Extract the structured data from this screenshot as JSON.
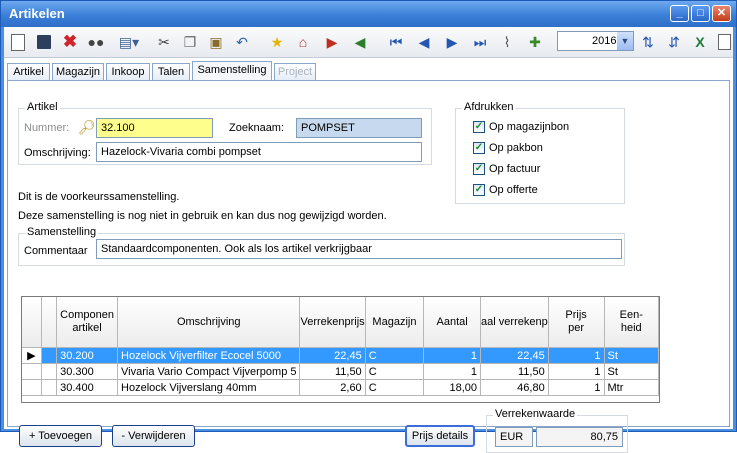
{
  "window": {
    "title": "Artikelen"
  },
  "toolbar": {
    "icons": [
      "new-icon",
      "save-icon",
      "delete-icon",
      "binoculars-icon",
      "print-icon",
      "cut-icon",
      "copy-icon",
      "paste-icon",
      "undo-icon",
      "star-icon",
      "house-icon",
      "export-icon",
      "import-icon",
      "first-icon",
      "prev-icon",
      "next-icon",
      "last-icon",
      "attach-icon",
      "add-icon",
      "sort-asc-icon",
      "sort-desc-icon",
      "excel-icon",
      "page-icon"
    ],
    "year": "2016"
  },
  "tabs": [
    {
      "label": "Artikel",
      "state": "normal"
    },
    {
      "label": "Magazijn",
      "state": "normal"
    },
    {
      "label": "Inkoop",
      "state": "normal"
    },
    {
      "label": "Talen",
      "state": "normal"
    },
    {
      "label": "Samenstelling",
      "state": "active"
    },
    {
      "label": "Project",
      "state": "disabled"
    }
  ],
  "artikel": {
    "legend": "Artikel",
    "nummer_label": "Nummer:",
    "nummer_value": "32.100",
    "zoeknaam_label": "Zoeknaam:",
    "zoeknaam_value": "POMPSET",
    "omschrijving_label": "Omschrijving:",
    "omschrijving_value": "Hazelock-Vivaria combi pompset"
  },
  "afdrukken": {
    "legend": "Afdrukken",
    "options": [
      {
        "label": "Op magazijnbon",
        "checked": true
      },
      {
        "label": "Op pakbon",
        "checked": true
      },
      {
        "label": "Op factuur",
        "checked": true
      },
      {
        "label": "Op offerte",
        "checked": true
      }
    ]
  },
  "messages": {
    "line1": "Dit is de voorkeurssamenstelling.",
    "line2": "Deze samenstelling is nog niet in gebruik en kan dus nog gewijzigd worden."
  },
  "samenstelling": {
    "legend": "Samenstelling",
    "commentaar_label": "Commentaar",
    "commentaar_value": "Standaardcomponenten. Ook als los artikel verkrijgbaar"
  },
  "grid": {
    "headers": [
      "Componen\nartikel",
      "Omschrijving",
      "Verrekenprijs",
      "Magazijn",
      "Aantal",
      "aal verrekenp",
      "Prijs\nper",
      "Een-\nheid"
    ],
    "rows": [
      {
        "artikel": "30.200",
        "omschrijving": "Hozelock Vijverfilter Ecocel 5000",
        "verrekenprijs": "22,45",
        "magazijn": "C",
        "aantal": "1",
        "totaal": "22,45",
        "per": "1",
        "eenheid": "St",
        "selected": true
      },
      {
        "artikel": "30.300",
        "omschrijving": "Vivaria Vario Compact Vijverpomp 5",
        "verrekenprijs": "11,50",
        "magazijn": "C",
        "aantal": "1",
        "totaal": "11,50",
        "per": "1",
        "eenheid": "St",
        "selected": false
      },
      {
        "artikel": "30.400",
        "omschrijving": "Hozelock Vijverslang 40mm",
        "verrekenprijs": "2,60",
        "magazijn": "C",
        "aantal": "18,00",
        "totaal": "46,80",
        "per": "1",
        "eenheid": "Mtr",
        "selected": false
      }
    ]
  },
  "buttons": {
    "toevoegen": "+ Toevoegen",
    "verwijderen": "- Verwijderen",
    "prijs_details": "Prijs details"
  },
  "verrekenwaarde": {
    "legend": "Verrekenwaarde",
    "currency": "EUR",
    "value": "80,75"
  }
}
